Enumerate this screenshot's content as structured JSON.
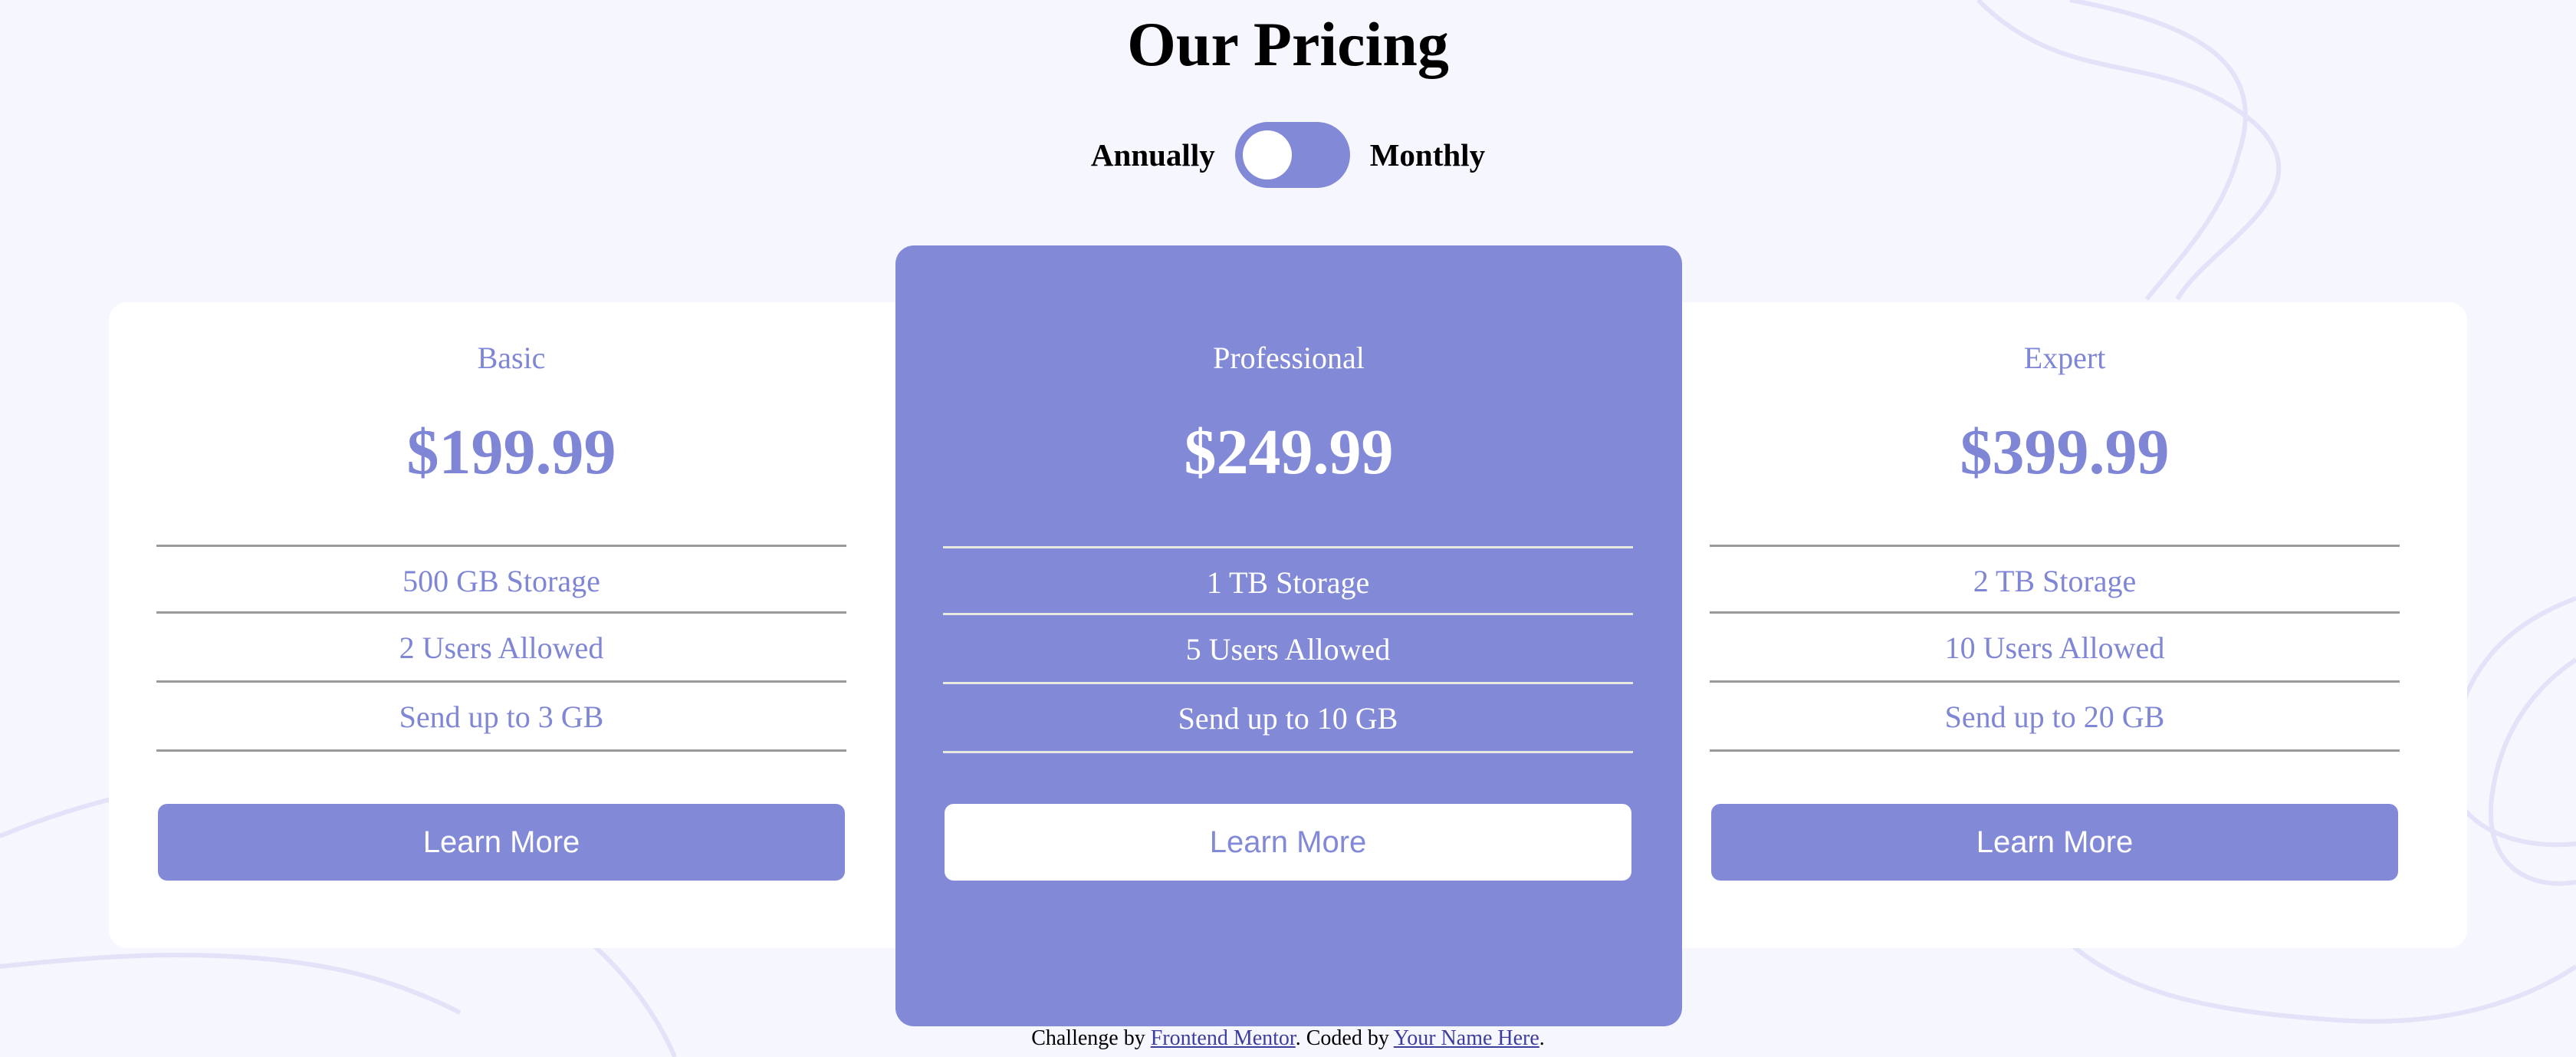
{
  "page": {
    "title": "Our Pricing"
  },
  "billing_toggle": {
    "left_label": "Annually",
    "right_label": "Monthly",
    "state": "annually"
  },
  "plans": [
    {
      "name": "Basic",
      "price": "$199.99",
      "features": [
        "500 GB Storage",
        "2 Users Allowed",
        "Send up to 3 GB"
      ],
      "button_label": "Learn More"
    },
    {
      "name": "Professional",
      "price": "$249.99",
      "features": [
        "1 TB Storage",
        "5 Users Allowed",
        "Send up to 10 GB"
      ],
      "button_label": "Learn More"
    },
    {
      "name": "Expert",
      "price": "$399.99",
      "features": [
        "2 TB Storage",
        "10 Users Allowed",
        "Send up to 20 GB"
      ],
      "button_label": "Learn More"
    }
  ],
  "attribution": {
    "prefix": "Challenge by ",
    "link1": "Frontend Mentor",
    "middle": ". Coded by ",
    "link2": "Your Name Here",
    "suffix": "."
  },
  "colors": {
    "accent": "#8289d7",
    "background": "#f6f6fe",
    "card": "#ffffff"
  }
}
